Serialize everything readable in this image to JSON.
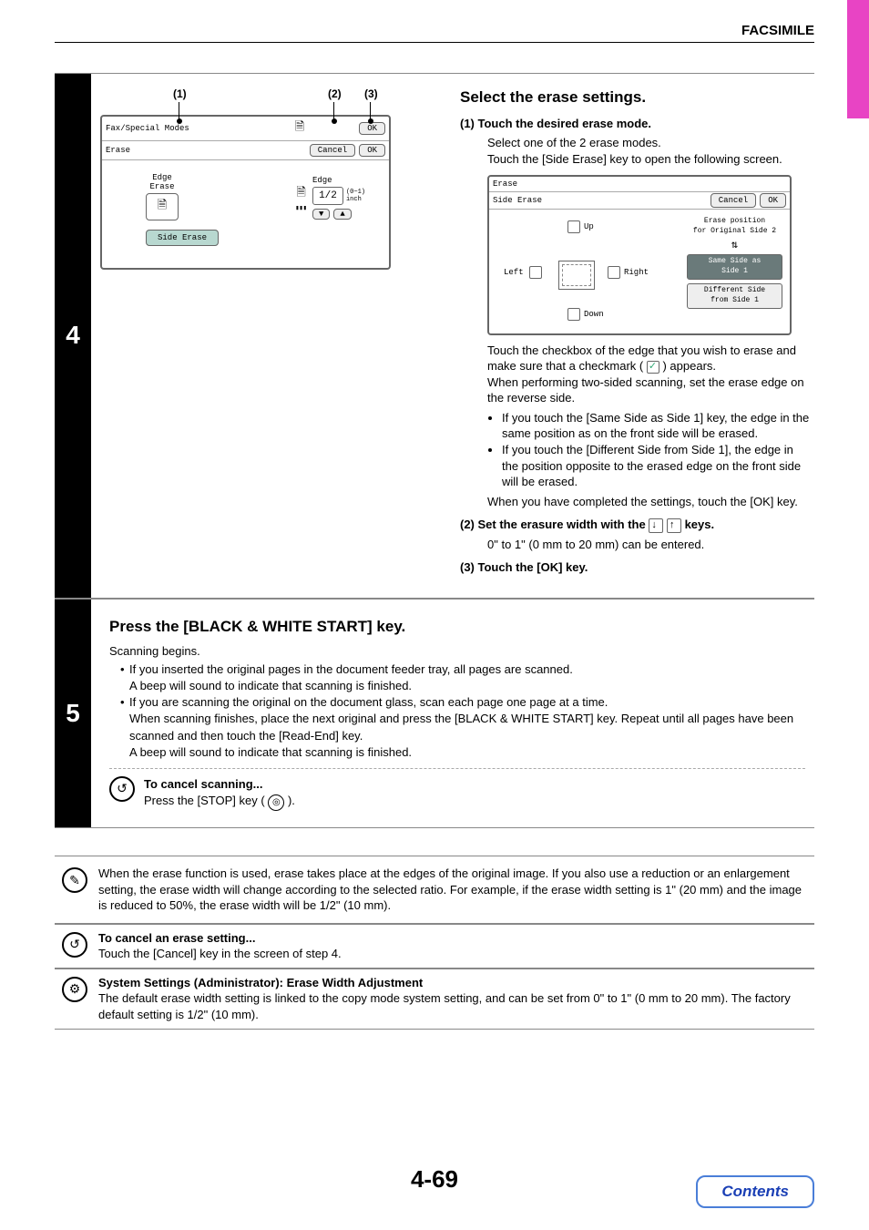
{
  "header_title": "FACSIMILE",
  "step4": {
    "num": "4",
    "callouts": {
      "c1": "(1)",
      "c2": "(2)",
      "c3": "(3)"
    },
    "screen1": {
      "row1_label": "Fax/Special Modes",
      "row1_ok": "OK",
      "row2_label": "Erase",
      "row2_cancel": "Cancel",
      "row2_ok": "OK",
      "edge_erase": "Edge\nErase",
      "edge": "Edge",
      "fraction": "1/2",
      "unit": "(0~1)\ninch",
      "side_erase_btn": "Side Erase"
    },
    "right": {
      "title": "Select the erase settings.",
      "h1": "(1)  Touch the desired erase mode.",
      "h1_p1": "Select one of the 2 erase modes.",
      "h1_p2": "Touch the [Side Erase] key to open the following screen.",
      "screen2": {
        "title": "Erase",
        "subtitle": "Side Erase",
        "cancel": "Cancel",
        "ok": "OK",
        "up": "Up",
        "left": "Left",
        "right": "Right",
        "down": "Down",
        "pos_label": "Erase position\nfor Original Side 2",
        "same": "Same Side as\nSide 1",
        "diff": "Different Side\nfrom Side 1"
      },
      "p_after1": "Touch the checkbox of the edge that you wish to erase and make sure that a checkmark (",
      "p_after1b": ") appears.",
      "p_after2": "When performing two-sided scanning, set the erase edge on the reverse side.",
      "b1": "If you touch the [Same Side as Side 1] key, the edge in the same position as on the front side will be erased.",
      "b2": "If you touch the [Different Side from Side 1], the edge in the position opposite to the erased edge on the front side will be erased.",
      "p_after3": "When you have completed the settings, touch the [OK] key.",
      "h2_a": "(2)  Set the erasure width with the ",
      "h2_b": " keys.",
      "h2_p": "0\" to 1\" (0 mm to 20 mm) can be entered.",
      "h3": "(3)  Touch the [OK] key."
    }
  },
  "step5": {
    "num": "5",
    "title": "Press the [BLACK & WHITE START] key.",
    "p1": "Scanning begins.",
    "b1a": "If you inserted the original pages in the document feeder tray, all pages are scanned.",
    "b1b": "A beep will sound to indicate that scanning is finished.",
    "b2a": "If you are scanning the original on the document glass, scan each page one page at a time.",
    "b2b": "When scanning finishes, place the next original and press the [BLACK & WHITE START] key. Repeat until all pages have been scanned and then touch the [Read-End] key.",
    "b2c": "A beep will sound to indicate that scanning is finished.",
    "cancel_h": "To cancel scanning...",
    "cancel_p_a": "Press the [STOP] key (",
    "cancel_p_b": ")."
  },
  "note1": "When the erase function is used, erase takes place at the edges of the original image. If you also use a reduction or an enlargement setting, the erase width will change according to the selected ratio. For example, if the erase width setting is 1\" (20 mm) and the image is reduced to 50%, the erase width will be 1/2\" (10 mm).",
  "note2_h": "To cancel an erase setting...",
  "note2_p": "Touch the [Cancel] key in the screen of step 4.",
  "note3_h": "System Settings (Administrator): Erase Width Adjustment",
  "note3_p": "The default erase width setting is linked to the copy mode system setting, and can be set from 0\" to 1\" (0 mm to 20 mm). The factory default setting is 1/2\" (10 mm).",
  "page_num": "4-69",
  "contents": "Contents"
}
